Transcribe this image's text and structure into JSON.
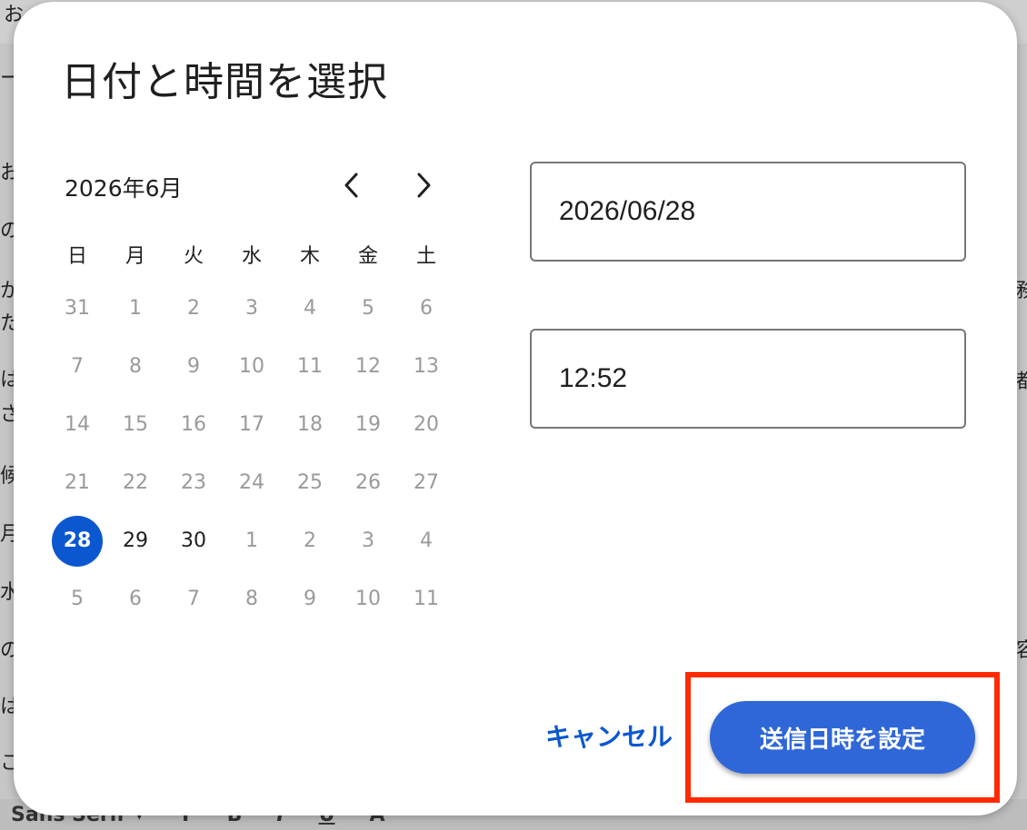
{
  "background": {
    "fragments_left": [
      "お",
      "ー",
      "お",
      "の",
      "か",
      "た",
      "は",
      "ざ",
      "候",
      "月",
      "水",
      "の",
      "は",
      "こ"
    ],
    "fragments_right": [
      "務",
      "都",
      "容"
    ],
    "toolbar": {
      "font_label": "Sans Serif",
      "items": [
        "T",
        "B",
        "I",
        "U",
        "A"
      ]
    }
  },
  "dialog": {
    "title": "日付と時間を選択",
    "calendar": {
      "month_label": "2026年6月",
      "weekdays": [
        "日",
        "月",
        "火",
        "水",
        "木",
        "金",
        "土"
      ],
      "weeks": [
        [
          {
            "d": "31",
            "c": false
          },
          {
            "d": "1",
            "c": false
          },
          {
            "d": "2",
            "c": false
          },
          {
            "d": "3",
            "c": false
          },
          {
            "d": "4",
            "c": false
          },
          {
            "d": "5",
            "c": false
          },
          {
            "d": "6",
            "c": false
          }
        ],
        [
          {
            "d": "7",
            "c": false
          },
          {
            "d": "8",
            "c": false
          },
          {
            "d": "9",
            "c": false
          },
          {
            "d": "10",
            "c": false
          },
          {
            "d": "11",
            "c": false
          },
          {
            "d": "12",
            "c": false
          },
          {
            "d": "13",
            "c": false
          }
        ],
        [
          {
            "d": "14",
            "c": false
          },
          {
            "d": "15",
            "c": false
          },
          {
            "d": "16",
            "c": false
          },
          {
            "d": "17",
            "c": false
          },
          {
            "d": "18",
            "c": false
          },
          {
            "d": "19",
            "c": false
          },
          {
            "d": "20",
            "c": false
          }
        ],
        [
          {
            "d": "21",
            "c": false
          },
          {
            "d": "22",
            "c": false
          },
          {
            "d": "23",
            "c": false
          },
          {
            "d": "24",
            "c": false
          },
          {
            "d": "25",
            "c": false
          },
          {
            "d": "26",
            "c": false
          },
          {
            "d": "27",
            "c": false
          }
        ],
        [
          {
            "d": "28",
            "c": true,
            "s": true
          },
          {
            "d": "29",
            "c": true
          },
          {
            "d": "30",
            "c": true
          },
          {
            "d": "1",
            "c": false
          },
          {
            "d": "2",
            "c": false
          },
          {
            "d": "3",
            "c": false
          },
          {
            "d": "4",
            "c": false
          }
        ],
        [
          {
            "d": "5",
            "c": false
          },
          {
            "d": "6",
            "c": false
          },
          {
            "d": "7",
            "c": false
          },
          {
            "d": "8",
            "c": false
          },
          {
            "d": "9",
            "c": false
          },
          {
            "d": "10",
            "c": false
          },
          {
            "d": "11",
            "c": false
          }
        ]
      ]
    },
    "date_value": "2026/06/28",
    "time_value": "12:52",
    "cancel_label": "キャンセル",
    "submit_label": "送信日時を設定"
  },
  "colors": {
    "accent": "#0b57d0",
    "submit_bg": "#2f67d8",
    "highlight": "#ff2a00"
  }
}
